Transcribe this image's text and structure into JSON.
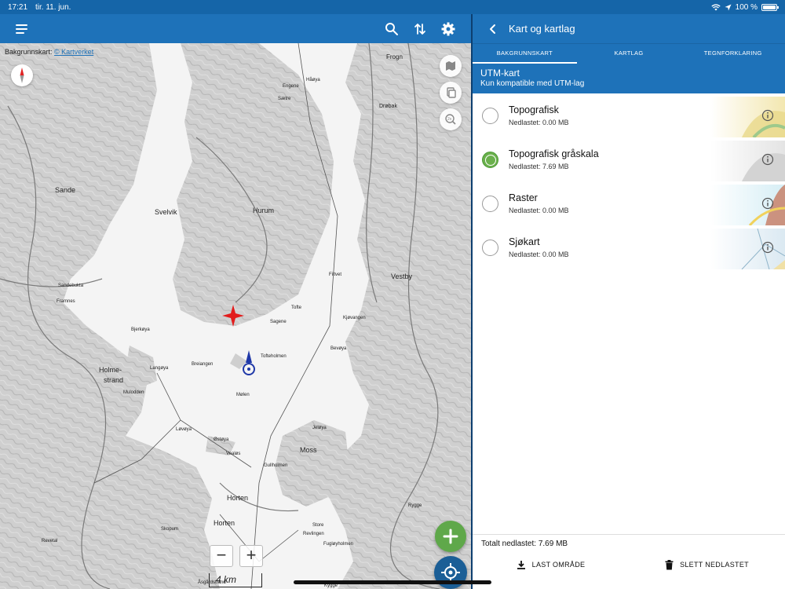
{
  "status_bar": {
    "time": "17:21",
    "date": "tir. 11. jun.",
    "battery": "100 %"
  },
  "map": {
    "attribution_prefix": "Bakgrunnskart:",
    "attribution_link": "© Kartverket",
    "zoom_in": "+",
    "zoom_out": "−",
    "scale": "4 km",
    "labels": [
      {
        "text": "Sande",
        "size": 9
      },
      {
        "text": "Svelvik",
        "size": 9
      },
      {
        "text": "Hurum",
        "size": 9
      },
      {
        "text": "Drøbak",
        "size": 7
      },
      {
        "text": "Vestby",
        "size": 9
      },
      {
        "text": "Holme-",
        "size": 9
      },
      {
        "text": "strand",
        "size": 9
      },
      {
        "text": "Moss",
        "size": 9
      },
      {
        "text": "Horten",
        "size": 9
      },
      {
        "text": "Horten",
        "size": 9
      },
      {
        "text": "Tofte",
        "size": 6
      },
      {
        "text": "Sagene",
        "size": 6
      },
      {
        "text": "Tofteholmen",
        "size": 6
      },
      {
        "text": "Breiangen",
        "size": 6
      },
      {
        "text": "Mølen",
        "size": 6
      },
      {
        "text": "Langøya",
        "size": 6
      },
      {
        "text": "Bjerkøya",
        "size": 6
      },
      {
        "text": "Mulodden",
        "size": 6
      },
      {
        "text": "Løvøya",
        "size": 6
      },
      {
        "text": "Østøya",
        "size": 6
      },
      {
        "text": "Vealøs",
        "size": 6
      },
      {
        "text": "Gullholmen",
        "size": 6
      },
      {
        "text": "Jeløya",
        "size": 6
      },
      {
        "text": "Kjøvangen",
        "size": 6
      },
      {
        "text": "Bevøya",
        "size": 6
      },
      {
        "text": "Filtvet",
        "size": 6
      },
      {
        "text": "Frogn",
        "size": 8
      },
      {
        "text": "Håøya",
        "size": 6
      },
      {
        "text": "Store",
        "size": 6
      },
      {
        "text": "Revlingen",
        "size": 6
      },
      {
        "text": "Fugløyholmen",
        "size": 6
      },
      {
        "text": "Framnes",
        "size": 6
      },
      {
        "text": "Sandebukta",
        "size": 6
      },
      {
        "text": "Skopum",
        "size": 6
      },
      {
        "text": "Revetal",
        "size": 6
      },
      {
        "text": "Kygge",
        "size": 6
      },
      {
        "text": "Åsgårdstrand",
        "size": 6
      },
      {
        "text": "Rygge",
        "size": 6
      },
      {
        "text": "Sætre",
        "size": 6
      },
      {
        "text": "Engene",
        "size": 6
      }
    ]
  },
  "panel": {
    "title": "Kart og kartlag",
    "tabs": [
      "BAKGRUNNSKART",
      "KARTLAG",
      "TEGNFORKLARING"
    ],
    "section_title": "UTM-kart",
    "section_subtitle": "Kun kompatible med UTM-lag",
    "items": [
      {
        "name": "Topografisk",
        "downloaded": "Nedlastet: 0.00 MB",
        "selected": false,
        "thumb": "terrain-color"
      },
      {
        "name": "Topografisk gråskala",
        "downloaded": "Nedlastet: 7.69 MB",
        "selected": true,
        "thumb": "terrain-gray"
      },
      {
        "name": "Raster",
        "downloaded": "Nedlastet: 0.00 MB",
        "selected": false,
        "thumb": "raster"
      },
      {
        "name": "Sjøkart",
        "downloaded": "Nedlastet: 0.00 MB",
        "selected": false,
        "thumb": "nautical"
      }
    ],
    "total": "Totalt nedlastet: 7.69 MB",
    "download_button": "LAST OMRÅDE",
    "delete_button": "SLETT NEDLASTET"
  },
  "colors": {
    "toolbar_blue": "#1e72b9",
    "fab_green": "#5fa84a",
    "fab_blue": "#1b5e96",
    "water": "#f4f4f4"
  },
  "icons": [
    "menu-icon",
    "search-icon",
    "sort-icon",
    "gear-icon",
    "compass-icon",
    "map-layers-icon",
    "copy-icon",
    "zoom-2x-icon",
    "plus-icon",
    "locate-icon",
    "back-chevron-icon",
    "info-icon",
    "download-icon",
    "trash-icon",
    "wifi-icon",
    "location-arrow-icon",
    "battery-icon"
  ]
}
